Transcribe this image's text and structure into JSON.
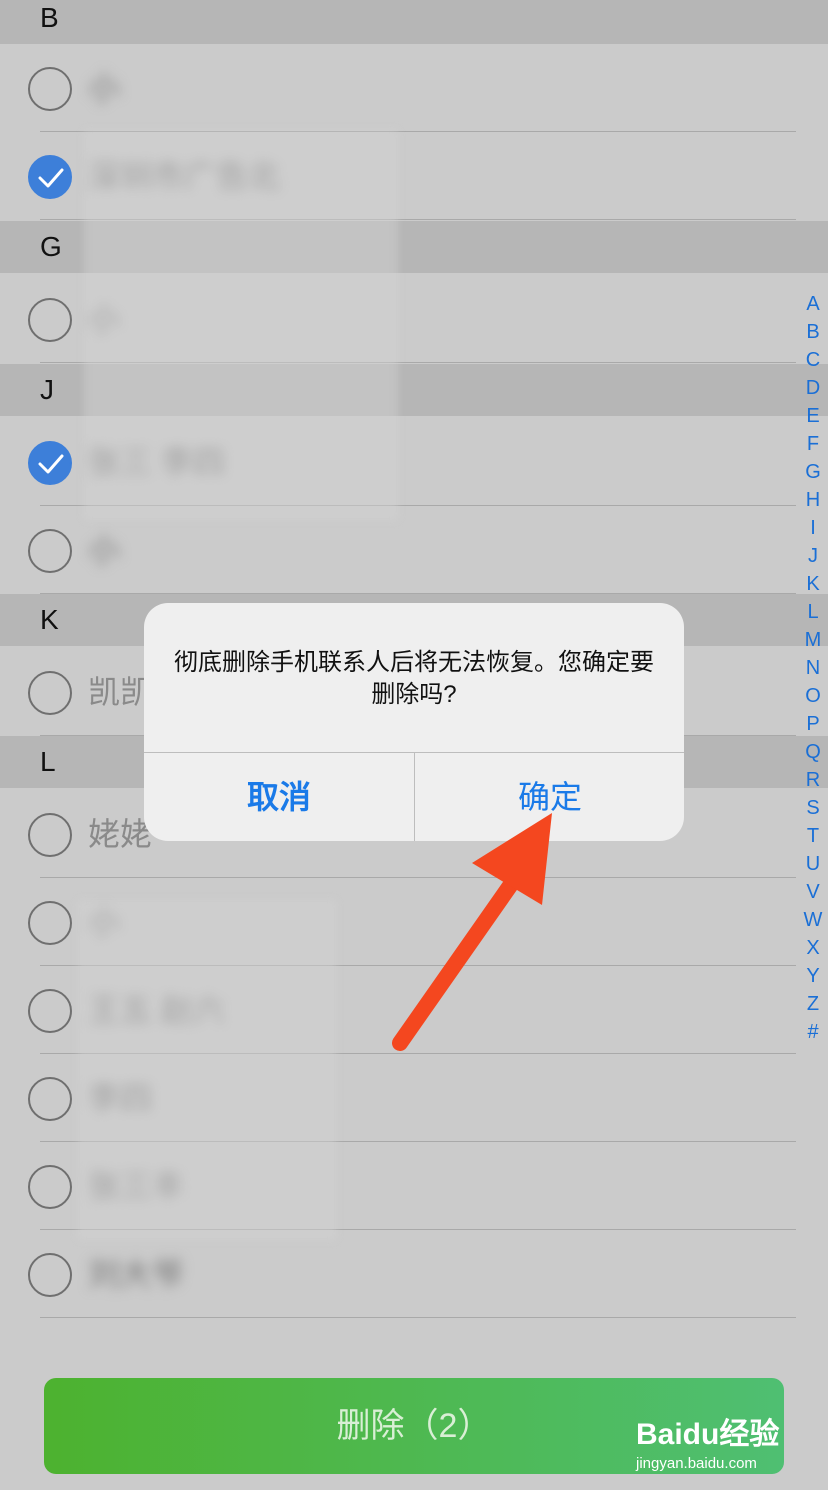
{
  "sections": [
    {
      "letter": "B",
      "rows": [
        {
          "name": "小",
          "checked": false,
          "blurred": true
        },
        {
          "name": "深圳市广告北",
          "checked": true,
          "blurred": true
        }
      ]
    },
    {
      "letter": "G",
      "rows": [
        {
          "name": "小",
          "checked": false,
          "blurred": true
        }
      ]
    },
    {
      "letter": "J",
      "rows": [
        {
          "name": "张三 李四",
          "checked": true,
          "blurred": true
        },
        {
          "name": "小",
          "checked": false,
          "blurred": true
        }
      ]
    },
    {
      "letter": "K",
      "rows": [
        {
          "name": "凯凯",
          "checked": false,
          "blurred": false
        }
      ]
    },
    {
      "letter": "L",
      "rows": [
        {
          "name": "姥姥",
          "checked": false,
          "blurred": false
        },
        {
          "name": "小",
          "checked": false,
          "blurred": true
        },
        {
          "name": "王五 赵六",
          "checked": false,
          "blurred": true
        },
        {
          "name": "李四",
          "checked": false,
          "blurred": true
        },
        {
          "name": "张三丰",
          "checked": false,
          "blurred": true
        },
        {
          "name": "刘大爷",
          "checked": false,
          "blurred": true
        }
      ]
    }
  ],
  "index_letters": [
    "A",
    "B",
    "C",
    "D",
    "E",
    "F",
    "G",
    "H",
    "I",
    "J",
    "K",
    "L",
    "M",
    "N",
    "O",
    "P",
    "Q",
    "R",
    "S",
    "T",
    "U",
    "V",
    "W",
    "X",
    "Y",
    "Z",
    "#"
  ],
  "dialog": {
    "message": "彻底删除手机联系人后将无法恢复。您确定要删除吗?",
    "cancel_label": "取消",
    "confirm_label": "确定"
  },
  "delete_button": {
    "label": "删除（2）"
  },
  "watermark": {
    "brand": "Baidu经验",
    "url": "jingyan.baidu.com"
  },
  "colors": {
    "accent": "#1a7ae8",
    "check": "#3d7fd9",
    "delete_green": "#4db22f",
    "arrow": "#f4471f"
  }
}
